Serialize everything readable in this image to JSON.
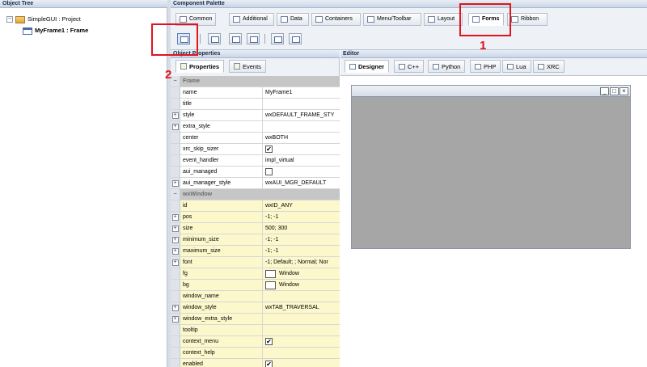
{
  "object_tree": {
    "title": "Object Tree",
    "nodes": [
      {
        "label": "SimpleGUI : Project"
      },
      {
        "label": "MyFrame1 : Frame"
      }
    ]
  },
  "component_palette": {
    "title": "Component Palette",
    "tabs": [
      {
        "label": "Common"
      },
      {
        "label": "Additional"
      },
      {
        "label": "Data"
      },
      {
        "label": "Containers"
      },
      {
        "label": "Menu/Toolbar"
      },
      {
        "label": "Layout"
      },
      {
        "label": "Forms"
      },
      {
        "label": "Ribbon"
      }
    ],
    "active_tab": "Forms"
  },
  "object_properties": {
    "title": "Object Properties",
    "tabs": [
      {
        "label": "Properties"
      },
      {
        "label": "Events"
      }
    ],
    "categories": [
      {
        "name": "Frame"
      },
      {
        "name": "wxWindow"
      }
    ],
    "rows": [
      {
        "name": "name",
        "value": "MyFrame1"
      },
      {
        "name": "title",
        "value": ""
      },
      {
        "name": "style",
        "value": "wxDEFAULT_FRAME_STY"
      },
      {
        "name": "extra_style",
        "value": ""
      },
      {
        "name": "center",
        "value": "wxBOTH"
      },
      {
        "name": "xrc_skip_sizer",
        "value": "checked"
      },
      {
        "name": "event_handler",
        "value": "impl_virtual"
      },
      {
        "name": "aui_managed",
        "value": "unchecked"
      },
      {
        "name": "aui_manager_style",
        "value": "wxAUI_MGR_DEFAULT"
      },
      {
        "name": "id",
        "value": "wxID_ANY"
      },
      {
        "name": "pos",
        "value": "-1; -1"
      },
      {
        "name": "size",
        "value": "500; 300"
      },
      {
        "name": "minimum_size",
        "value": "-1; -1"
      },
      {
        "name": "maximum_size",
        "value": "-1; -1"
      },
      {
        "name": "font",
        "value": "-1; Default; ; Normal; Nor"
      },
      {
        "name": "fg",
        "value": "Window"
      },
      {
        "name": "bg",
        "value": "Window"
      },
      {
        "name": "window_name",
        "value": ""
      },
      {
        "name": "window_style",
        "value": "wxTAB_TRAVERSAL"
      },
      {
        "name": "window_extra_style",
        "value": ""
      },
      {
        "name": "tooltip",
        "value": ""
      },
      {
        "name": "context_menu",
        "value": "checked"
      },
      {
        "name": "context_help",
        "value": ""
      },
      {
        "name": "enabled",
        "value": "checked"
      }
    ]
  },
  "editor": {
    "title": "Editor",
    "tabs": [
      {
        "label": "Designer"
      },
      {
        "label": "C++"
      },
      {
        "label": "Python"
      },
      {
        "label": "PHP"
      },
      {
        "label": "Lua"
      },
      {
        "label": "XRC"
      }
    ],
    "active_tab": "Designer",
    "frame_buttons": [
      "_",
      "□",
      "×"
    ]
  },
  "annotations": [
    {
      "label": "1"
    },
    {
      "label": "2"
    }
  ],
  "colors": {
    "annotation": "#e0141e",
    "category_row": "#c6c6c6",
    "highlight_row": "#fcf8cc"
  }
}
